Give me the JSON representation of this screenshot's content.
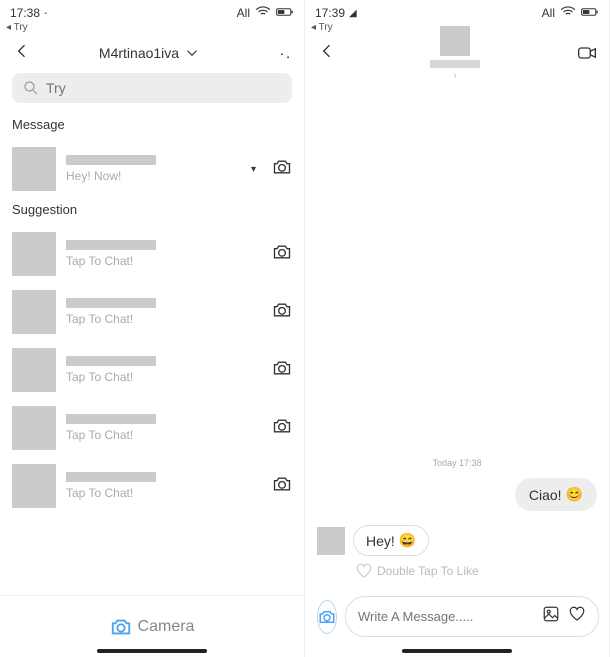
{
  "left": {
    "status": {
      "time": "17:38",
      "back_app": "◂ Try",
      "right": "All"
    },
    "header": {
      "title": "M4rtinao1iva"
    },
    "search": {
      "placeholder": "Try"
    },
    "sections": {
      "message_label": "Message",
      "suggestion_label": "Suggestion"
    },
    "messages": [
      {
        "preview": "Hey! Now!"
      }
    ],
    "suggestions": [
      {
        "preview": "Tap To Chat!"
      },
      {
        "preview": "Tap To Chat!"
      },
      {
        "preview": "Tap To Chat!"
      },
      {
        "preview": "Tap To Chat!"
      },
      {
        "preview": "Tap To Chat!"
      }
    ],
    "bottom": {
      "camera": "Camera"
    }
  },
  "right": {
    "status": {
      "time": "17:39",
      "back_app": "◂ Try",
      "right": "All"
    },
    "chat": {
      "timestamp": "Today 17:38",
      "sent": "Ciao!",
      "received": "Hey!",
      "double_tap": "Double Tap To Like"
    },
    "composer": {
      "placeholder": "Write A Message....."
    }
  }
}
